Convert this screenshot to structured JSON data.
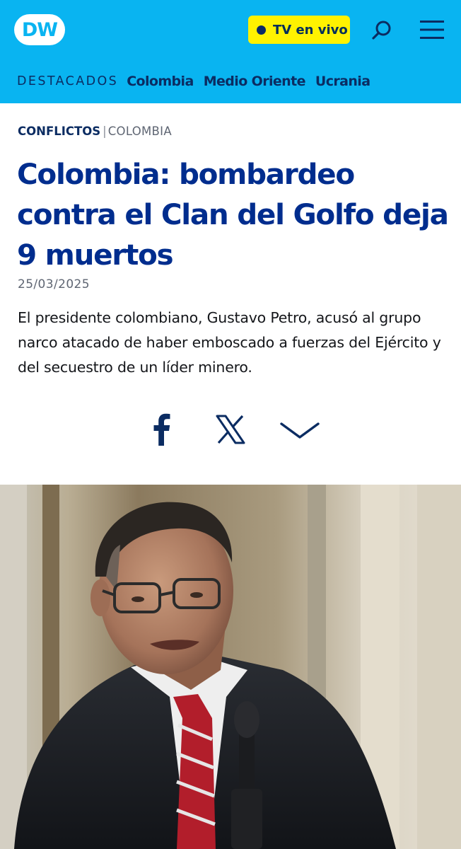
{
  "header": {
    "logo_text": "DW",
    "live_button_label": "TV en vivo",
    "search_icon": "search-icon",
    "menu_icon": "hamburger-menu-icon",
    "colors": {
      "header_bg": "#09b4f1",
      "live_bg": "#fff200",
      "navy": "#0b2c62"
    }
  },
  "nav": {
    "label": "DESTACADOS",
    "links": [
      "Colombia",
      "Medio Oriente",
      "Ucrania"
    ]
  },
  "article": {
    "category": "CONFLICTOS",
    "separator": "|",
    "subcategory": "COLOMBIA",
    "headline": "Colombia: bombardeo contra el Clan del Golfo deja 9 muertos",
    "date": "25/03/2025",
    "lead": "El presidente colombiano, Gustavo Petro, acusó al grupo narco atacado de haber emboscado a fuerzas del Ejército y del secuestro de un líder minero.",
    "headline_color": "#002d8e"
  },
  "share": {
    "icons": [
      "facebook-icon",
      "x-icon",
      "chevron-down-icon"
    ]
  }
}
